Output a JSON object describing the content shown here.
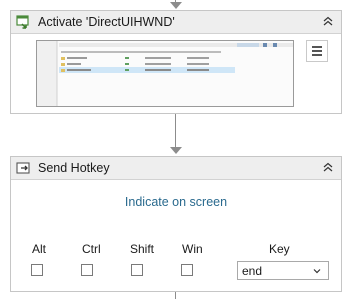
{
  "activate": {
    "title": "Activate 'DirectUIHWND'",
    "icons": [
      "activate-window-icon",
      "collapse-chevron-icon",
      "hamburger-menu-icon"
    ]
  },
  "hotkey": {
    "title": "Send Hotkey",
    "indicate_label": "Indicate on screen",
    "modifiers": {
      "alt": "Alt",
      "ctrl": "Ctrl",
      "shift": "Shift",
      "win": "Win"
    },
    "key_label": "Key",
    "key_value": "end",
    "icons": [
      "send-hotkey-icon",
      "collapse-chevron-icon",
      "dropdown-chevron-icon"
    ]
  },
  "colors": {
    "header_bg": "#eeeeee",
    "border": "#c6c6c6",
    "link": "#2a6a8e",
    "connector": "#8c8c8c"
  }
}
